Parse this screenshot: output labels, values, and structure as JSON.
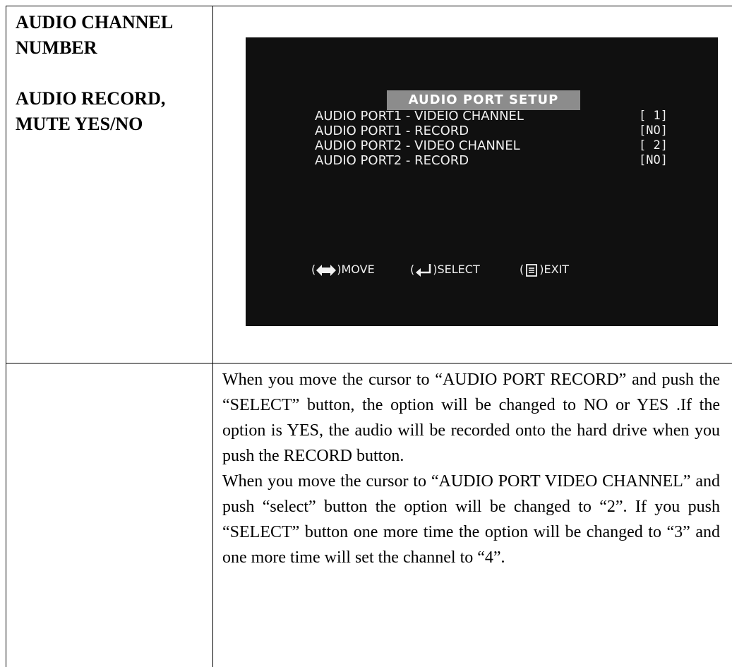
{
  "left_labels": {
    "audio_channel": "AUDIO CHANNEL NUMBER",
    "audio_record": "AUDIO RECORD, MUTE YES/NO"
  },
  "osd": {
    "title": "AUDIO PORT SETUP",
    "rows": [
      {
        "label": "AUDIO PORT1 - VIDEIO CHANNEL",
        "value": "[ 1]"
      },
      {
        "label": "AUDIO PORT1 - RECORD",
        "value": "[NO]"
      },
      {
        "label": "AUDIO PORT2 - VIDEO CHANNEL",
        "value": "[ 2]"
      },
      {
        "label": "AUDIO PORT2 - RECORD",
        "value": "[NO]"
      }
    ],
    "footer": {
      "move": "MOVE",
      "select": "SELECT",
      "exit": "EXIT"
    },
    "icons": [
      "left-right-arrow-icon",
      "enter-icon",
      "menu-icon"
    ]
  },
  "description": {
    "para1": "When you move the cursor to “AUDIO PORT RECORD” and push the “SELECT” button, the option will be changed to NO or YES .If the option is YES, the audio will be recorded onto the hard drive when you push the RECORD button.",
    "para2": "When you move the cursor to “AUDIO PORT VIDEO CHANNEL” and push “select” button the option will be changed to “2”. If you push “SELECT” button one more time the option will be changed to “3” and one more time will set the channel to “4”."
  }
}
